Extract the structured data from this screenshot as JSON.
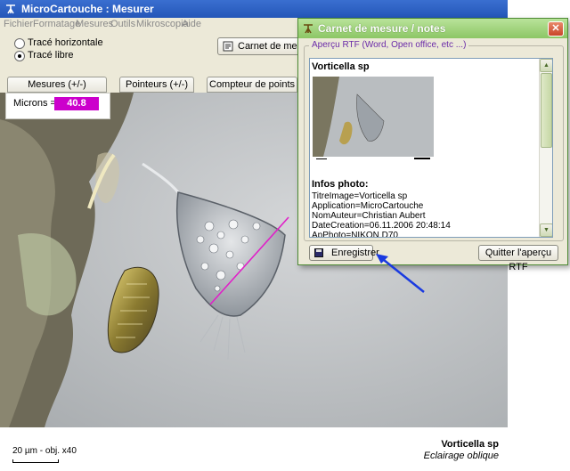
{
  "window": {
    "title": "MicroCartouche : Mesurer",
    "icon": "tripod-icon"
  },
  "menu": {
    "items": [
      "Fichier",
      "Formatage",
      "Mesures",
      "Outils",
      "Mikroscopia",
      "Aide"
    ]
  },
  "trace": {
    "options": [
      {
        "label": "Tracé horizontale",
        "selected": false
      },
      {
        "label": "Tracé libre",
        "selected": true
      }
    ]
  },
  "toolbar": {
    "carnet_label": "Carnet de mesures"
  },
  "tabs": [
    {
      "label": "Mesures (+/-)"
    },
    {
      "label": "Pointeurs (+/-)"
    },
    {
      "label": "Compteur de points (+/-)"
    }
  ],
  "measure": {
    "label": "Microns =",
    "value": "40.8",
    "value_color": "#cc00cc"
  },
  "caption": {
    "title": "Vorticella sp",
    "subtitle": "Eclairage oblique",
    "scale": "20 µm - obj. x40"
  },
  "dialog": {
    "title": "Carnet de mesure / notes",
    "group_label": "Aperçu RTF (Word, Open office, etc ...)",
    "rtf_title": "Vorticella sp",
    "infos_heading": "Infos photo:",
    "infos": [
      "TitreImage=Vorticella sp",
      "Application=MicroCartouche",
      "NomAuteur=Christian Aubert",
      "DateCreation=06.11.2006 20:48:14",
      "ApPhoto=NIKON D70"
    ],
    "save_label": "Enregistrer",
    "quit_label": "Quitter l'aperçu RTF",
    "accent": "#8cc665"
  },
  "arrow_color": "#1a3ae0",
  "measure_line_color": "#e020c8"
}
